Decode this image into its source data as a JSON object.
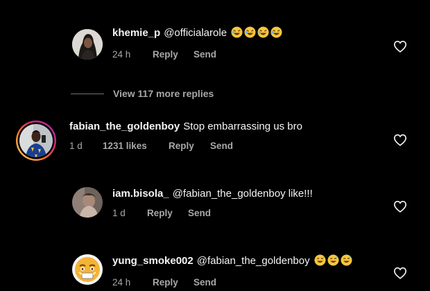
{
  "colors": {
    "background": "#000000",
    "primary_text": "#f5f5f5",
    "secondary_text": "#a8a8a8",
    "story_ring": [
      "#feda75",
      "#fa7e1e",
      "#d62976",
      "#962fbf"
    ]
  },
  "comments": [
    {
      "username": "khemie_p",
      "mention": "@officialarole",
      "text": "",
      "emoji": [
        "rofl-emoji",
        "rofl-emoji",
        "rofl-emoji",
        "rofl-emoji"
      ],
      "time": "24 h",
      "likes": "",
      "reply_label": "Reply",
      "send_label": "Send",
      "icon": "heart-outline-icon"
    },
    {
      "username": "fabian_the_goldenboy",
      "mention": "",
      "text": "Stop embarrassing us bro",
      "emoji": [],
      "time": "1 d",
      "likes": "1231 likes",
      "reply_label": "Reply",
      "send_label": "Send",
      "icon": "heart-outline-icon"
    },
    {
      "username": "iam.bisola_",
      "mention": "@fabian_the_goldenboy",
      "text": "like!!!",
      "emoji": [],
      "time": "1 d",
      "likes": "",
      "reply_label": "Reply",
      "send_label": "Send",
      "icon": "heart-outline-icon"
    },
    {
      "username": "yung_smoke002",
      "mention": "@fabian_the_goldenboy",
      "text": "",
      "emoji": [
        "grinning-sweat-emoji",
        "grinning-sweat-emoji",
        "grinning-sweat-emoji"
      ],
      "time": "24 h",
      "likes": "",
      "reply_label": "Reply",
      "send_label": "Send",
      "icon": "heart-outline-icon"
    }
  ],
  "view_more": {
    "label": "View 117 more replies"
  }
}
